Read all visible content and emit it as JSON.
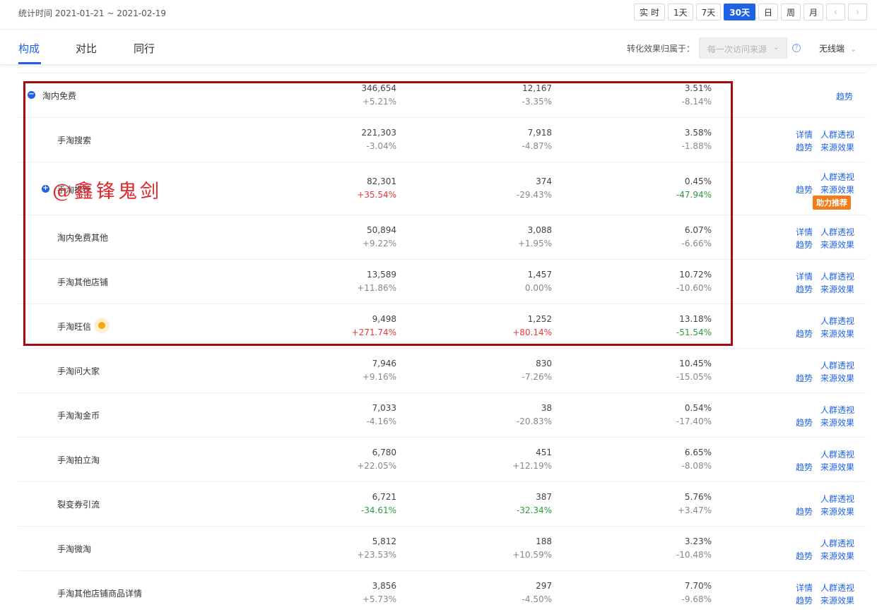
{
  "header": {
    "stat_time": "统计时间 2021-01-21 ~ 2021-02-19",
    "ranges": [
      "实 时",
      "1天",
      "7天",
      "30天",
      "日",
      "周",
      "月"
    ],
    "active_range": "30天"
  },
  "tabs": {
    "composition": "构成",
    "compare": "对比",
    "peer": "同行"
  },
  "filters": {
    "attribution_label": "转化效果归属于：",
    "attribution_value": "每一次访问来源",
    "device": "无线端"
  },
  "watermark": "@鑫锋鬼剑",
  "rows": [
    {
      "name": "淘内免费",
      "v1": "346,654",
      "c1": "+5.21%",
      "v2": "12,167",
      "c2": "-3.35%",
      "v3": "3.51%",
      "c3": "-8.14%"
    },
    {
      "name": "手淘搜索",
      "v1": "221,303",
      "c1": "-3.04%",
      "v2": "7,918",
      "c2": "-4.87%",
      "v3": "3.58%",
      "c3": "-1.88%"
    },
    {
      "name": "手淘推荐",
      "v1": "82,301",
      "c1": "+35.54%",
      "v2": "374",
      "c2": "-29.43%",
      "v3": "0.45%",
      "c3": "-47.94%"
    },
    {
      "name": "淘内免费其他",
      "v1": "50,894",
      "c1": "+9.22%",
      "v2": "3,088",
      "c2": "+1.95%",
      "v3": "6.07%",
      "c3": "-6.66%"
    },
    {
      "name": "手淘其他店铺",
      "v1": "13,589",
      "c1": "+11.86%",
      "v2": "1,457",
      "c2": "0.00%",
      "v3": "10.72%",
      "c3": "-10.60%"
    },
    {
      "name": "手淘旺信",
      "v1": "9,498",
      "c1": "+271.74%",
      "v2": "1,252",
      "c2": "+80.14%",
      "v3": "13.18%",
      "c3": "-51.54%"
    },
    {
      "name": "手淘问大家",
      "v1": "7,946",
      "c1": "+9.16%",
      "v2": "830",
      "c2": "-7.26%",
      "v3": "10.45%",
      "c3": "-15.05%"
    },
    {
      "name": "手淘淘金币",
      "v1": "7,033",
      "c1": "-4.16%",
      "v2": "38",
      "c2": "-20.83%",
      "v3": "0.54%",
      "c3": "-17.40%"
    },
    {
      "name": "手淘拍立淘",
      "v1": "6,780",
      "c1": "+22.05%",
      "v2": "451",
      "c2": "+12.19%",
      "v3": "6.65%",
      "c3": "-8.08%"
    },
    {
      "name": "裂变券引流",
      "v1": "6,721",
      "c1": "-34.61%",
      "v2": "387",
      "c2": "-32.34%",
      "v3": "5.76%",
      "c3": "+3.47%"
    },
    {
      "name": "手淘微淘",
      "v1": "5,812",
      "c1": "+23.53%",
      "v2": "188",
      "c2": "+10.59%",
      "v3": "3.23%",
      "c3": "-10.48%"
    },
    {
      "name": "手淘其他店铺商品详情",
      "v1": "3,856",
      "c1": "+5.73%",
      "v2": "297",
      "c2": "-4.50%",
      "v3": "7.70%",
      "c3": "-9.68%"
    }
  ],
  "actions": {
    "trend": "趋势",
    "detail": "详情",
    "crowd": "人群透视",
    "source": "来源效果",
    "boost": "助力推荐"
  }
}
